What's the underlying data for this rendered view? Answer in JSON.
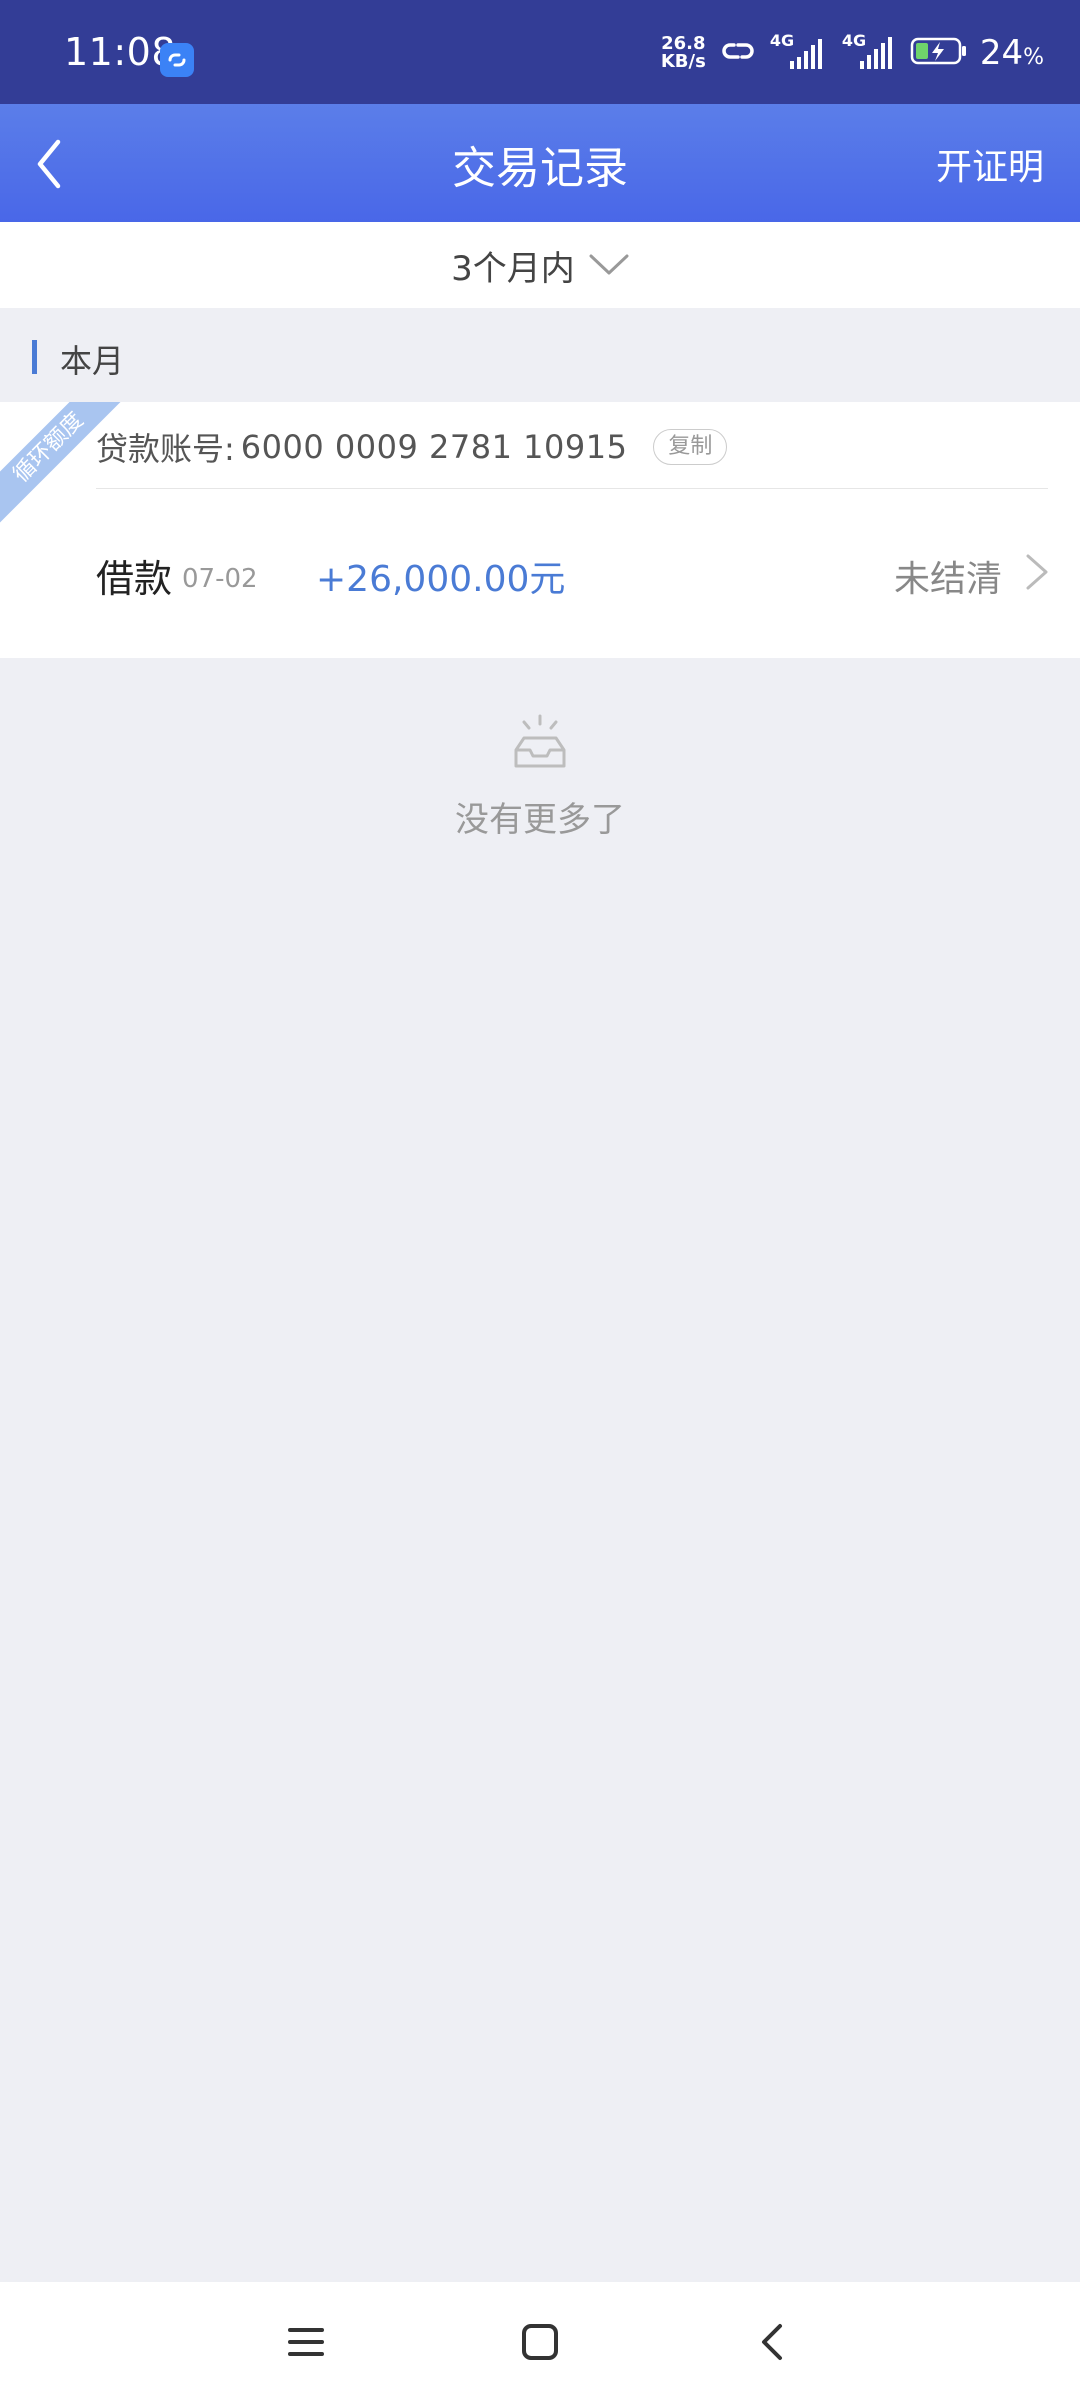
{
  "status_bar": {
    "time": "11:08",
    "net_speed_value": "26.8",
    "net_speed_unit": "KB/s",
    "net_type_1": "4G",
    "net_type_2": "4G",
    "battery_percent": "24",
    "battery_unit": "%"
  },
  "nav": {
    "title": "交易记录",
    "action_label": "开证明"
  },
  "filter": {
    "label": "3个月内"
  },
  "section": {
    "label": "本月"
  },
  "loan_card": {
    "ribbon_label": "循环额度",
    "account_label": "贷款账号:",
    "account_number": "6000 0009 2781 10915",
    "copy_label": "复制",
    "transaction": {
      "type": "借款",
      "date": "07-02",
      "amount": "+26,000.00元",
      "status": "未结清"
    }
  },
  "empty_state": {
    "text": "没有更多了"
  },
  "colors": {
    "status_bar_bg": "#333d96",
    "nav_bg": "#4f6ee8",
    "accent_blue": "#4a7bd5",
    "page_bg": "#eeeff4"
  }
}
